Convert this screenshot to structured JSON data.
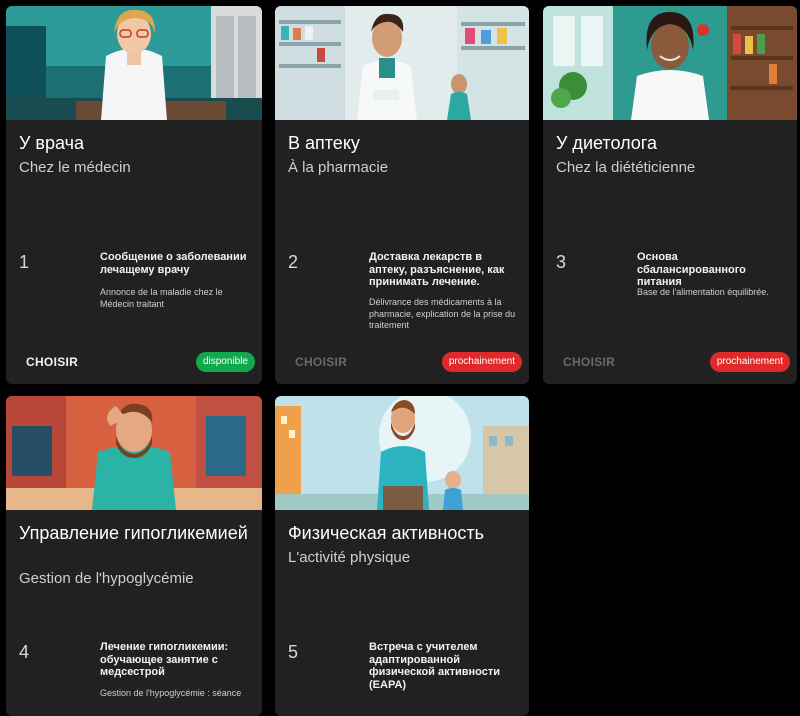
{
  "colors": {
    "background": "#000000",
    "card": "#212121",
    "available": "#12a84c",
    "soon": "#e02a2a"
  },
  "cards": [
    {
      "title": "У врача",
      "subtitle": "Chez le médecin",
      "number": "1",
      "description": "Сообщение о заболевании лечащему врачу",
      "description_fr": "Annonce de la maladie chez le Médecin traitant",
      "action": "CHOISIR",
      "status": "disponible",
      "image": "doctor-illustration"
    },
    {
      "title": "В аптеку",
      "subtitle": "À la pharmacie",
      "number": "2",
      "description": "Доставка лекарств в аптеку, разъяснение, как принимать лечение.",
      "description_fr": "Délivrance des médicaments à la pharmacie, explication de la prise du traitement",
      "action": "CHOISIR",
      "status": "prochainement",
      "image": "pharmacist-illustration"
    },
    {
      "title": "У диетолога",
      "subtitle": "Chez la diététicienne",
      "number": "3",
      "description": "Основа сбалансированного питания",
      "description_fr": "Base de l'alimentation équilibrée.",
      "action": "CHOISIR",
      "status": "prochainement",
      "image": "dietitian-illustration"
    },
    {
      "title": "Управление гипогликемией",
      "subtitle": "Gestion de l'hypoglycémie",
      "number": "4",
      "description": "Лечение гипогликемии: обучающее занятие с медсестрой",
      "description_fr": "Gestion de l'hypoglycémie : séance",
      "image": "dizzy-man-illustration"
    },
    {
      "title": "Физическая активность",
      "subtitle": "L'activité physique",
      "number": "5",
      "description": "Встреча с учителем адаптированной физической активности (EAPA)",
      "image": "running-father-son-illustration"
    }
  ]
}
